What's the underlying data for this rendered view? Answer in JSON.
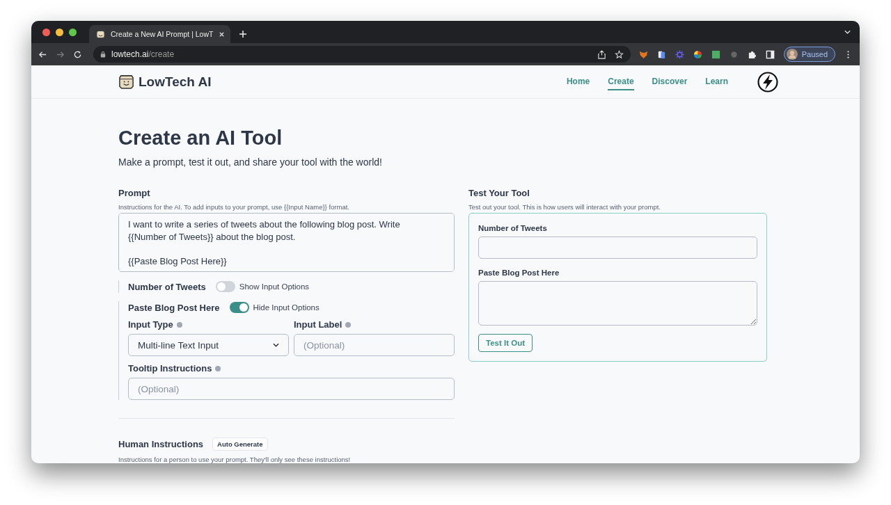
{
  "browser": {
    "tab_title": "Create a New AI Prompt | LowT",
    "url_host": "lowtech.ai",
    "url_path": "/create",
    "profile_label": "Paused"
  },
  "nav": {
    "brand": "LowTech AI",
    "links": [
      {
        "label": "Home",
        "selected": false
      },
      {
        "label": "Create",
        "selected": true
      },
      {
        "label": "Discover",
        "selected": false
      },
      {
        "label": "Learn",
        "selected": false
      }
    ]
  },
  "page": {
    "title": "Create an AI Tool",
    "subtitle": "Make a prompt, test it out, and share your tool with the world!"
  },
  "prompt": {
    "label": "Prompt",
    "hint": "Instructions for the AI. To add inputs to your prompt, use {{Input Name}} format.",
    "value": "I want to write a series of tweets about the following blog post. Write {{Number of Tweets}} about the blog post.\n\n{{Paste Blog Post Here}}"
  },
  "inputs": [
    {
      "name": "Number of Tweets",
      "toggle_label": "Show Input Options",
      "on": false
    },
    {
      "name": "Paste Blog Post Here",
      "toggle_label": "Hide Input Options",
      "on": true,
      "options": {
        "type_label": "Input Type",
        "type_value": "Multi-line Text Input",
        "label_label": "Input Label",
        "label_placeholder": "(Optional)",
        "tooltip_label": "Tooltip Instructions",
        "tooltip_placeholder": "(Optional)"
      }
    }
  ],
  "test": {
    "title": "Test Your Tool",
    "hint": "Test out your tool. This is how users will interact with your prompt.",
    "fields": [
      {
        "label": "Number of Tweets",
        "kind": "line"
      },
      {
        "label": "Paste Blog Post Here",
        "kind": "multiline"
      }
    ],
    "button": "Test It Out"
  },
  "human": {
    "label": "Human Instructions",
    "button": "Auto Generate",
    "hint": "Instructions for a person to use your prompt. They'll only see these instructions!"
  }
}
